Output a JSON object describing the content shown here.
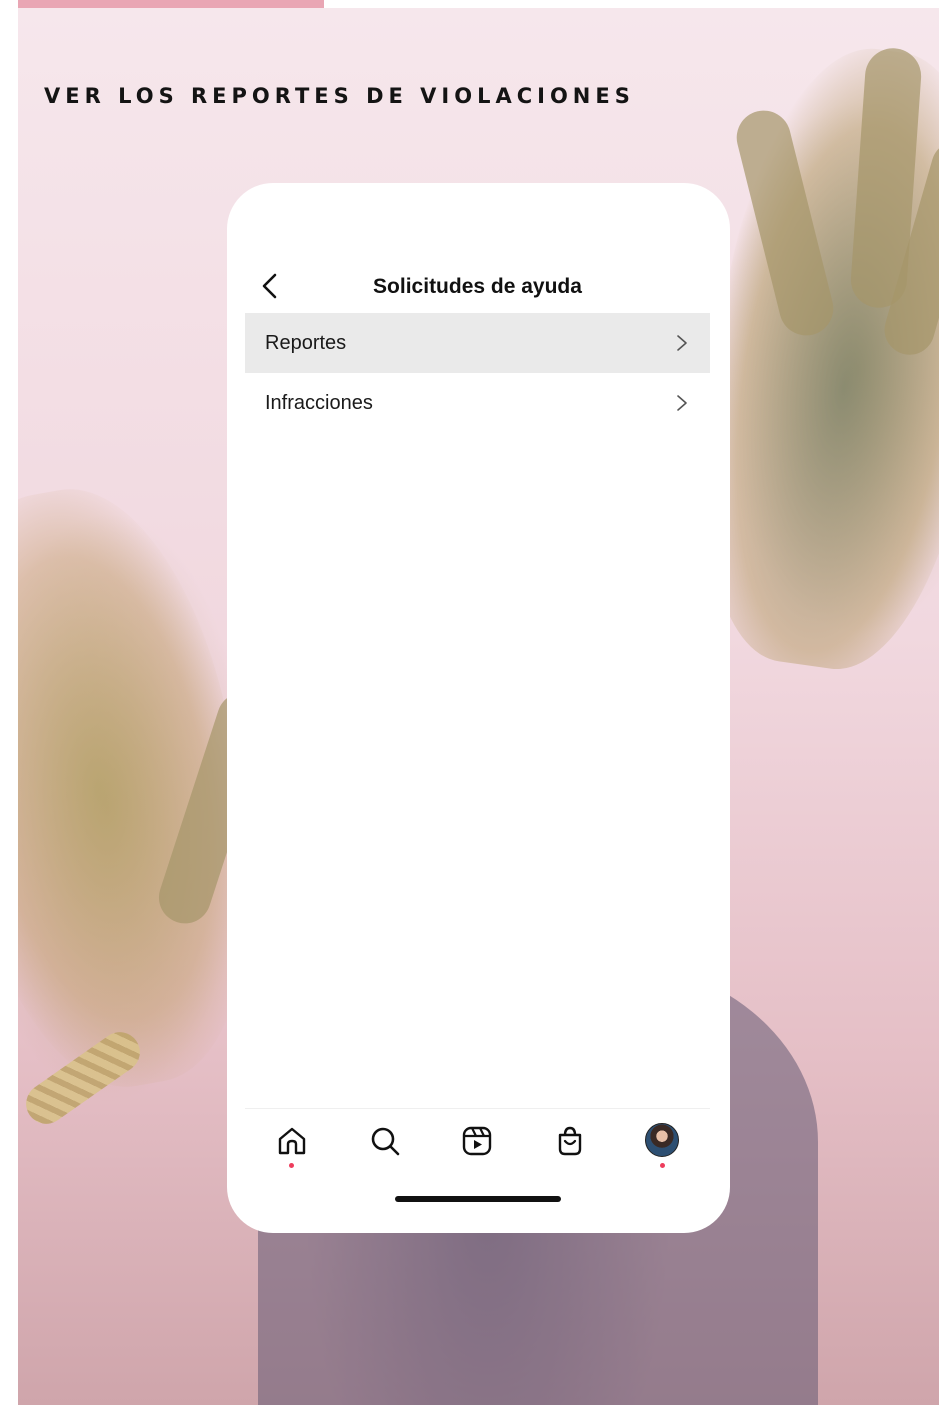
{
  "page": {
    "heading": "VER LOS REPORTES DE VIOLACIONES",
    "accent_color": "#e9a6b4"
  },
  "app": {
    "nav": {
      "title": "Solicitudes de ayuda",
      "back_icon": "chevron-left-icon"
    },
    "menu": [
      {
        "label": "Reportes",
        "selected": true
      },
      {
        "label": "Infracciones",
        "selected": false
      }
    ],
    "tabbar": [
      {
        "icon": "home-icon",
        "notification_dot": true
      },
      {
        "icon": "search-icon",
        "notification_dot": false
      },
      {
        "icon": "reels-icon",
        "notification_dot": false
      },
      {
        "icon": "shop-icon",
        "notification_dot": false
      },
      {
        "icon": "profile-avatar-icon",
        "notification_dot": true
      }
    ],
    "notification_color": "#ed3d5c"
  }
}
